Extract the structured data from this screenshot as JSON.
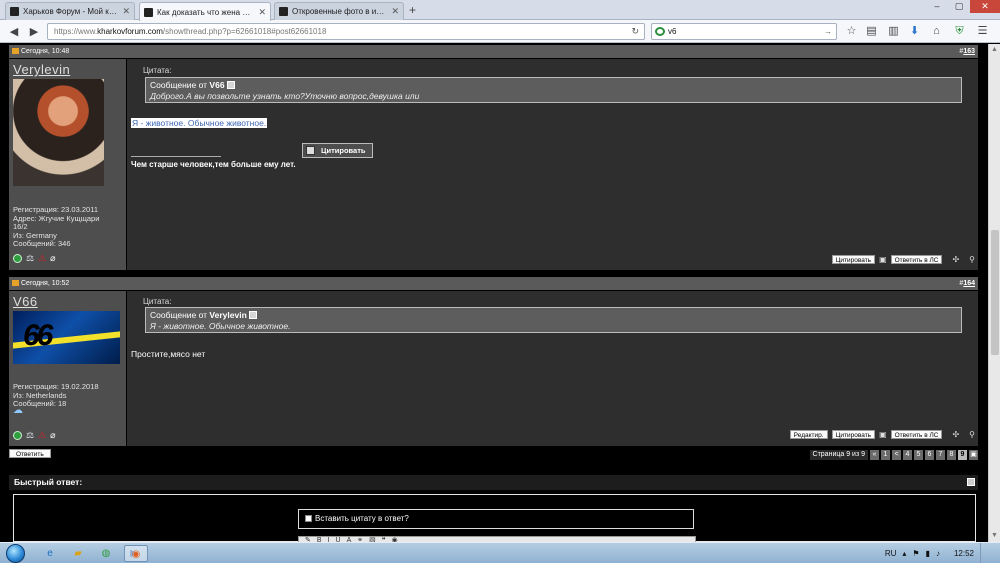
{
  "browser": {
    "tabs": [
      {
        "label": "Харьков Форум - Мой ка..."
      },
      {
        "label": "Как доказать что жена ев..."
      },
      {
        "label": "Откровенные фото в инст..."
      }
    ],
    "url_prefix": "https://www.",
    "url_host": "kharkovforum.com",
    "url_rest": "/showthread.php?p=62661018#post62661018",
    "search_value": "v6"
  },
  "posts": [
    {
      "header_time": "Сегодня, 10:48",
      "post_number_prefix": "#",
      "post_number": "163",
      "username": "Verylevin",
      "info": [
        "Регистрация: 23.03.2011",
        "Адрес: Жгучие Кущщари",
        "16/2",
        "Из: Germany",
        "Сообщений: 346"
      ],
      "quote_label": "Цитата:",
      "quote_from_prefix": "Сообщение от ",
      "quote_author": "V66",
      "quote_text": "Доброго.А вы позвольте узнать кто?Уточню вопрос,девушка или",
      "message": "Я - животное. Обычное животное.",
      "quote_popup_label": "Цитировать",
      "signature": "Чем старше человек,тем больше ему лет.",
      "quote_button": "Цитировать",
      "pm_button": "Ответить в ЛС"
    },
    {
      "header_time": "Сегодня, 10:52",
      "post_number_prefix": "#",
      "post_number": "164",
      "username": "V66",
      "avatar_text": "66",
      "info": [
        "Регистрация: 19.02.2018",
        "Из: Netherlands",
        "Сообщений: 18"
      ],
      "quote_label": "Цитата:",
      "quote_from_prefix": "Сообщение от ",
      "quote_author": "Verylevin",
      "quote_text": "Я - животное. Обычное животное.",
      "message": "Простите,мясо нет",
      "edit_button": "Редактир.",
      "quote_button": "Цитировать",
      "pm_button": "Ответить в ЛС"
    }
  ],
  "reply_button": "Ответить",
  "pager": {
    "label": "Страница 9 из 9",
    "items": [
      "«",
      "1",
      "<",
      "4",
      "5",
      "6",
      "7",
      "8",
      "9"
    ],
    "current": "9"
  },
  "quick_reply": {
    "title": "Быстрый ответ:",
    "insert_quote_label": "Вставить цитату в ответ?"
  },
  "taskbar": {
    "lang": "RU",
    "time": "12:52"
  }
}
